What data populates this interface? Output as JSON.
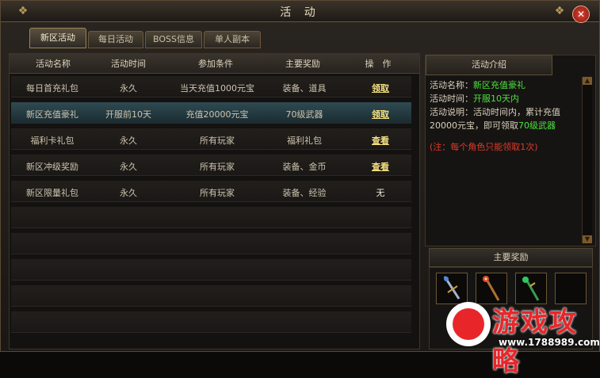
{
  "window": {
    "title": "活 动",
    "close_glyph": "✕"
  },
  "tabs": [
    {
      "label": "新区活动",
      "active": true
    },
    {
      "label": "每日活动",
      "active": false
    },
    {
      "label": "BOSS信息",
      "active": false
    },
    {
      "label": "单人副本",
      "active": false
    }
  ],
  "table": {
    "headers": [
      "活动名称",
      "活动时间",
      "参加条件",
      "主要奖励",
      "操　作"
    ],
    "rows": [
      {
        "name": "每日首充礼包",
        "time": "永久",
        "condition": "当天充值1000元宝",
        "reward": "装备、道具",
        "action": "领取"
      },
      {
        "name": "新区充值豪礼",
        "time": "开服前10天",
        "condition": "充值20000元宝",
        "reward": "70级武器",
        "action": "领取"
      },
      {
        "name": "福利卡礼包",
        "time": "永久",
        "condition": "所有玩家",
        "reward": "福利礼包",
        "action": "查看"
      },
      {
        "name": "新区冲级奖励",
        "time": "永久",
        "condition": "所有玩家",
        "reward": "装备、金币",
        "action": "查看"
      },
      {
        "name": "新区限量礼包",
        "time": "永久",
        "condition": "所有玩家",
        "reward": "装备、经验",
        "action": "无"
      }
    ]
  },
  "intro": {
    "header": "活动介绍",
    "name_label": "活动名称：",
    "name_value": "新区充值豪礼",
    "time_label": "活动时间：",
    "time_value": "开服10天内",
    "desc_label": "活动说明：活动时间内，累计充值20000元宝，即可领取",
    "desc_value": "70级武器",
    "note": "(注：每个角色只能领取1次)"
  },
  "rewards": {
    "header": "主要奖励",
    "icons": [
      "sword-icon",
      "staff-icon",
      "scepter-icon",
      "empty-slot"
    ]
  },
  "watermark": {
    "title": "游戏攻略",
    "url": "www.1788989.com"
  },
  "colors": {
    "highlight_green": "#4ee040",
    "note_red": "#e03a2a",
    "action_gold": "#f4e080",
    "selected_row": "#2f4a52"
  }
}
